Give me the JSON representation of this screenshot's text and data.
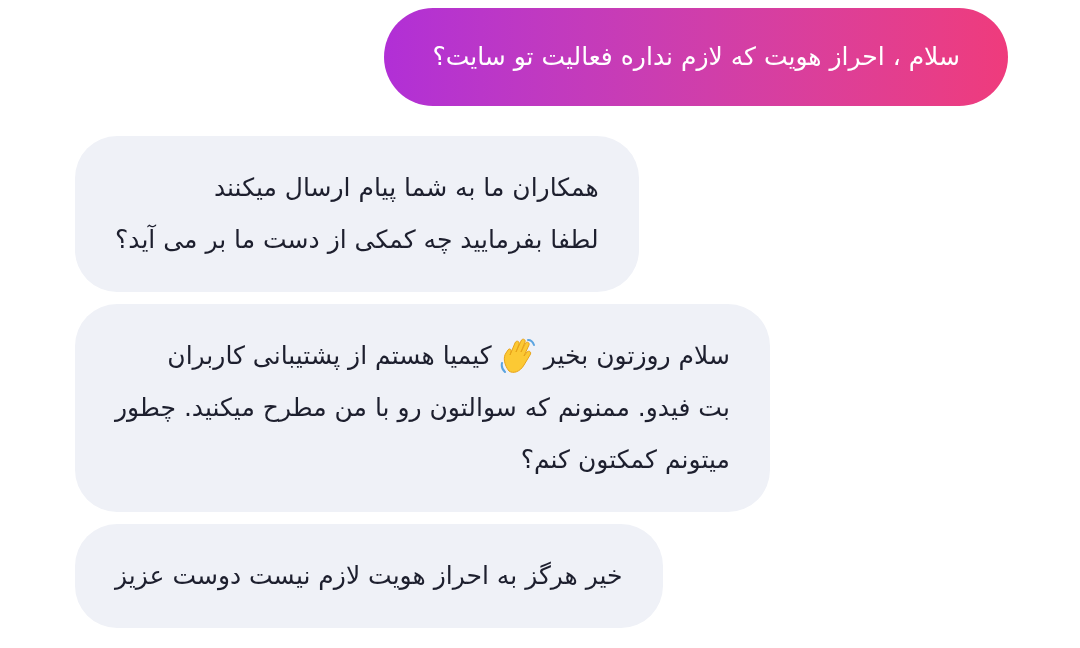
{
  "messages": [
    {
      "kind": "sent",
      "lines": [
        [
          {
            "kind": "text",
            "text": "سلام ، احراز هویت که لازم نداره فعالیت تو سایت؟"
          }
        ]
      ]
    },
    {
      "kind": "received",
      "lines": [
        [
          {
            "kind": "text",
            "text": "همکاران ما به شما پیام ارسال میکنند"
          }
        ],
        [
          {
            "kind": "text",
            "text": "لطفا بفرمایید چه کمکی از دست ما بر می آید؟"
          }
        ]
      ]
    },
    {
      "kind": "received",
      "lines": [
        [
          {
            "kind": "text",
            "text": "سلام روزتون بخیر"
          },
          {
            "kind": "wave"
          },
          {
            "kind": "text",
            "text": "کیمیا هستم از پشتیبانی کاربران"
          }
        ],
        [
          {
            "kind": "text",
            "text": "بت فیدو. ممنونم که سوالتون رو با من مطرح میکنید. چطور"
          }
        ],
        [
          {
            "kind": "text",
            "text": "میتونم کمکتون کنم؟"
          }
        ]
      ]
    },
    {
      "kind": "received",
      "lines": [
        [
          {
            "kind": "text",
            "text": "خیر هرگز به احراز هویت لازم نیست دوست عزیز"
          }
        ]
      ]
    }
  ]
}
